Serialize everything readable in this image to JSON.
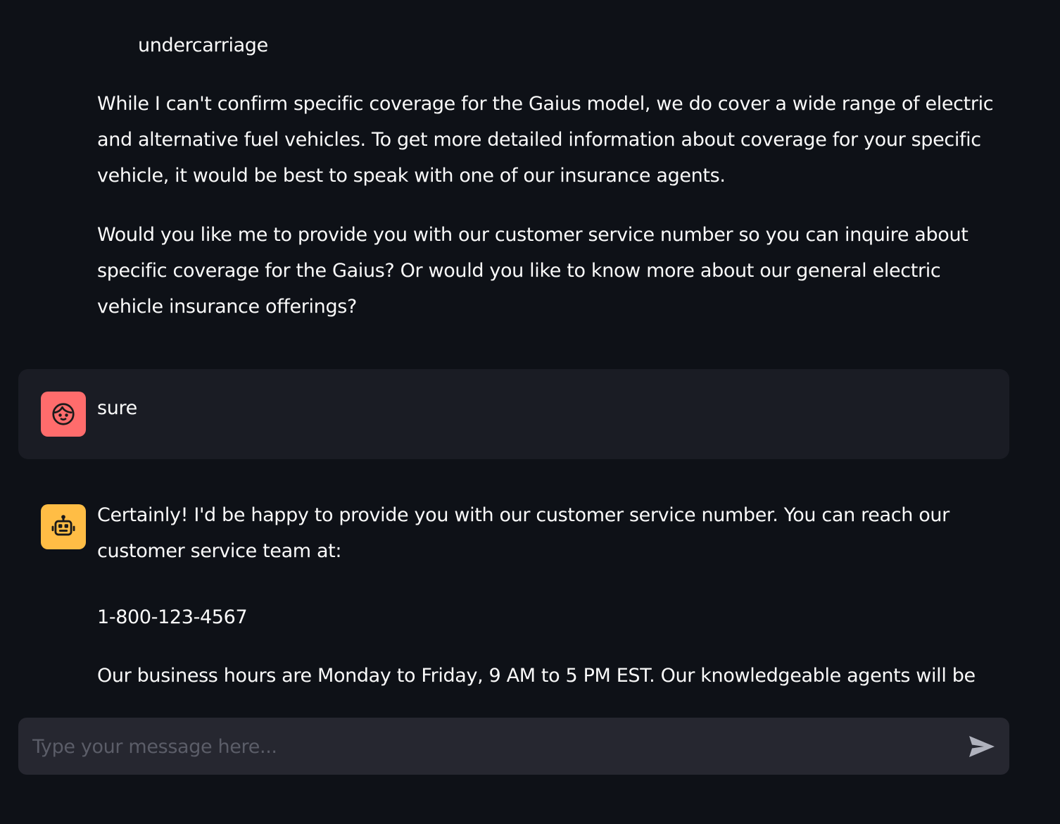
{
  "chat": {
    "previous_assistant": {
      "list_tail": "undercarriage",
      "paragraph_1": "While I can't confirm specific coverage for the Gaius model, we do cover a wide range of electric and alternative fuel vehicles. To get more detailed information about coverage for your specific vehicle, it would be best to speak with one of our insurance agents.",
      "paragraph_2": "Would you like me to provide you with our customer service number so you can inquire about specific coverage for the Gaius? Or would you like to know more about our general electric vehicle insurance offerings?"
    },
    "user_message": {
      "avatar_icon": "user-face-icon",
      "avatar_color": "#ff6c6c",
      "text": "sure"
    },
    "assistant_message": {
      "avatar_icon": "robot-icon",
      "avatar_color": "#ffbd45",
      "paragraph_1": "Certainly! I'd be happy to provide you with our customer service number. You can reach our customer service team at:",
      "phone": "1-800-123-4567",
      "paragraph_3": "Our business hours are Monday to Friday, 9 AM to 5 PM EST. Our knowledgeable agents will be"
    }
  },
  "input": {
    "placeholder": "Type your message here...",
    "value": "",
    "send_icon": "send-arrow-icon"
  }
}
